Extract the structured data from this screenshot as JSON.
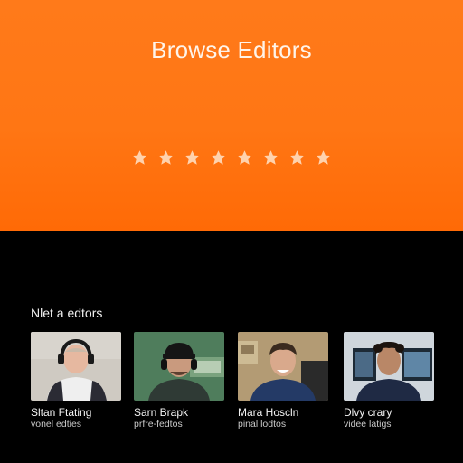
{
  "hero": {
    "title": "Browse Editors",
    "rating_stars": 8,
    "accent_color": "#ff7614"
  },
  "editors_section": {
    "label": "Nlet a edtors",
    "editors": [
      {
        "name": "Sltan Ftating",
        "role": "vonel edties",
        "thumb_bg": "#c9c6c0"
      },
      {
        "name": "Sarn Brapk",
        "role": "prfre-fedtos",
        "thumb_bg": "#5f8f6a"
      },
      {
        "name": "Mara Hoscln",
        "role": "pinal lodtos",
        "thumb_bg": "#b8a27a"
      },
      {
        "name": "Dlvy crary",
        "role": "videe latigs",
        "thumb_bg": "#6f7f8f"
      }
    ]
  }
}
